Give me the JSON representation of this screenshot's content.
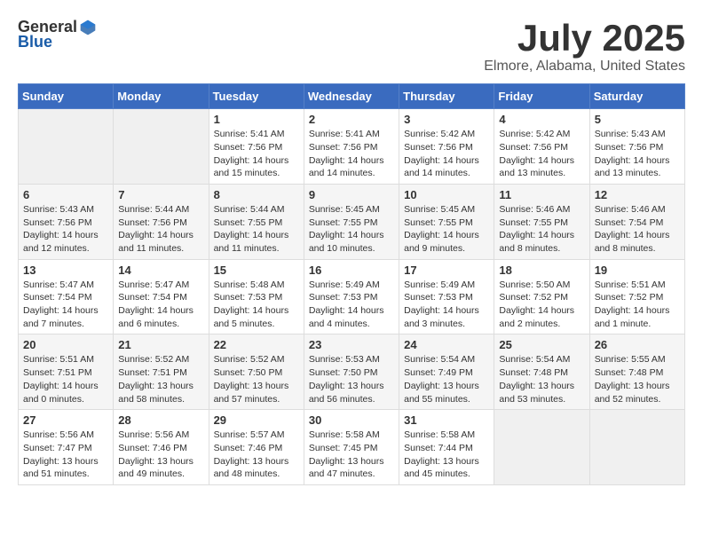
{
  "header": {
    "logo": {
      "general": "General",
      "blue": "Blue"
    },
    "title": "July 2025",
    "location": "Elmore, Alabama, United States"
  },
  "weekdays": [
    "Sunday",
    "Monday",
    "Tuesday",
    "Wednesday",
    "Thursday",
    "Friday",
    "Saturday"
  ],
  "weeks": [
    [
      {
        "day": "",
        "info": ""
      },
      {
        "day": "",
        "info": ""
      },
      {
        "day": "1",
        "info": "Sunrise: 5:41 AM\nSunset: 7:56 PM\nDaylight: 14 hours\nand 15 minutes."
      },
      {
        "day": "2",
        "info": "Sunrise: 5:41 AM\nSunset: 7:56 PM\nDaylight: 14 hours\nand 14 minutes."
      },
      {
        "day": "3",
        "info": "Sunrise: 5:42 AM\nSunset: 7:56 PM\nDaylight: 14 hours\nand 14 minutes."
      },
      {
        "day": "4",
        "info": "Sunrise: 5:42 AM\nSunset: 7:56 PM\nDaylight: 14 hours\nand 13 minutes."
      },
      {
        "day": "5",
        "info": "Sunrise: 5:43 AM\nSunset: 7:56 PM\nDaylight: 14 hours\nand 13 minutes."
      }
    ],
    [
      {
        "day": "6",
        "info": "Sunrise: 5:43 AM\nSunset: 7:56 PM\nDaylight: 14 hours\nand 12 minutes."
      },
      {
        "day": "7",
        "info": "Sunrise: 5:44 AM\nSunset: 7:56 PM\nDaylight: 14 hours\nand 11 minutes."
      },
      {
        "day": "8",
        "info": "Sunrise: 5:44 AM\nSunset: 7:55 PM\nDaylight: 14 hours\nand 11 minutes."
      },
      {
        "day": "9",
        "info": "Sunrise: 5:45 AM\nSunset: 7:55 PM\nDaylight: 14 hours\nand 10 minutes."
      },
      {
        "day": "10",
        "info": "Sunrise: 5:45 AM\nSunset: 7:55 PM\nDaylight: 14 hours\nand 9 minutes."
      },
      {
        "day": "11",
        "info": "Sunrise: 5:46 AM\nSunset: 7:55 PM\nDaylight: 14 hours\nand 8 minutes."
      },
      {
        "day": "12",
        "info": "Sunrise: 5:46 AM\nSunset: 7:54 PM\nDaylight: 14 hours\nand 8 minutes."
      }
    ],
    [
      {
        "day": "13",
        "info": "Sunrise: 5:47 AM\nSunset: 7:54 PM\nDaylight: 14 hours\nand 7 minutes."
      },
      {
        "day": "14",
        "info": "Sunrise: 5:47 AM\nSunset: 7:54 PM\nDaylight: 14 hours\nand 6 minutes."
      },
      {
        "day": "15",
        "info": "Sunrise: 5:48 AM\nSunset: 7:53 PM\nDaylight: 14 hours\nand 5 minutes."
      },
      {
        "day": "16",
        "info": "Sunrise: 5:49 AM\nSunset: 7:53 PM\nDaylight: 14 hours\nand 4 minutes."
      },
      {
        "day": "17",
        "info": "Sunrise: 5:49 AM\nSunset: 7:53 PM\nDaylight: 14 hours\nand 3 minutes."
      },
      {
        "day": "18",
        "info": "Sunrise: 5:50 AM\nSunset: 7:52 PM\nDaylight: 14 hours\nand 2 minutes."
      },
      {
        "day": "19",
        "info": "Sunrise: 5:51 AM\nSunset: 7:52 PM\nDaylight: 14 hours\nand 1 minute."
      }
    ],
    [
      {
        "day": "20",
        "info": "Sunrise: 5:51 AM\nSunset: 7:51 PM\nDaylight: 14 hours\nand 0 minutes."
      },
      {
        "day": "21",
        "info": "Sunrise: 5:52 AM\nSunset: 7:51 PM\nDaylight: 13 hours\nand 58 minutes."
      },
      {
        "day": "22",
        "info": "Sunrise: 5:52 AM\nSunset: 7:50 PM\nDaylight: 13 hours\nand 57 minutes."
      },
      {
        "day": "23",
        "info": "Sunrise: 5:53 AM\nSunset: 7:50 PM\nDaylight: 13 hours\nand 56 minutes."
      },
      {
        "day": "24",
        "info": "Sunrise: 5:54 AM\nSunset: 7:49 PM\nDaylight: 13 hours\nand 55 minutes."
      },
      {
        "day": "25",
        "info": "Sunrise: 5:54 AM\nSunset: 7:48 PM\nDaylight: 13 hours\nand 53 minutes."
      },
      {
        "day": "26",
        "info": "Sunrise: 5:55 AM\nSunset: 7:48 PM\nDaylight: 13 hours\nand 52 minutes."
      }
    ],
    [
      {
        "day": "27",
        "info": "Sunrise: 5:56 AM\nSunset: 7:47 PM\nDaylight: 13 hours\nand 51 minutes."
      },
      {
        "day": "28",
        "info": "Sunrise: 5:56 AM\nSunset: 7:46 PM\nDaylight: 13 hours\nand 49 minutes."
      },
      {
        "day": "29",
        "info": "Sunrise: 5:57 AM\nSunset: 7:46 PM\nDaylight: 13 hours\nand 48 minutes."
      },
      {
        "day": "30",
        "info": "Sunrise: 5:58 AM\nSunset: 7:45 PM\nDaylight: 13 hours\nand 47 minutes."
      },
      {
        "day": "31",
        "info": "Sunrise: 5:58 AM\nSunset: 7:44 PM\nDaylight: 13 hours\nand 45 minutes."
      },
      {
        "day": "",
        "info": ""
      },
      {
        "day": "",
        "info": ""
      }
    ]
  ]
}
